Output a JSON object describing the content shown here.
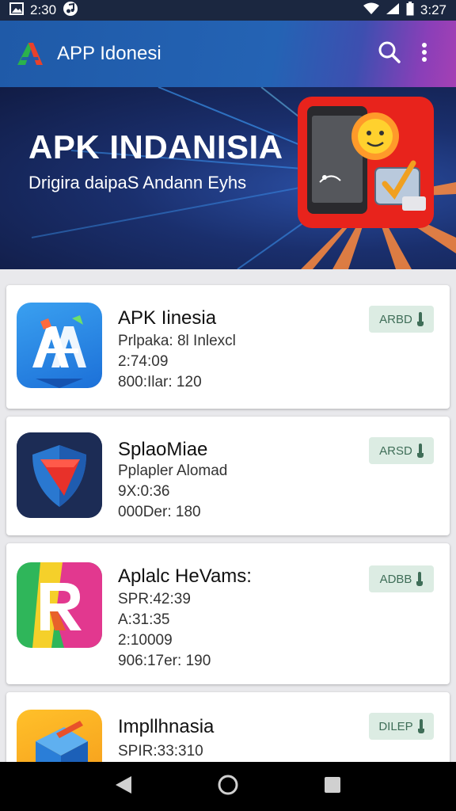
{
  "status_bar": {
    "time": "2:30",
    "battery_time": "3:27",
    "icons": [
      "image-icon",
      "music-icon",
      "wifi-icon",
      "signal-icon",
      "battery-icon"
    ]
  },
  "app_bar": {
    "title": "APP Idonesi",
    "actions": [
      "search-icon",
      "more-vert-icon"
    ],
    "colors": {
      "start": "#1f5aa8",
      "end": "#a540b4"
    }
  },
  "banner": {
    "title": "APK INDANISIA",
    "subtitle": "Drigira daipaS Andann Eyhs"
  },
  "apps": [
    {
      "name": "APK Iinesia",
      "meta": [
        "Prlpaka: 8l Inlexcl",
        "2:74:09",
        "800:Ilar: 120"
      ],
      "button": "ARBD",
      "icon": "apk-icon"
    },
    {
      "name": "SplaoMiae",
      "meta": [
        "Pplapler Alomad",
        "9X:0:36",
        "000Der: 180"
      ],
      "button": "ARSD",
      "icon": "shield-icon"
    },
    {
      "name": "Aplalc HeVams:",
      "meta": [
        "SPR:42:39",
        "A:31:35",
        "2:10009",
        "906:17er: 190"
      ],
      "button": "ADBB",
      "icon": "r-logo-icon"
    },
    {
      "name": "Impllhnasia",
      "meta": [
        "SPIR:33:310"
      ],
      "button": "DILEP",
      "icon": "box-icon"
    }
  ]
}
